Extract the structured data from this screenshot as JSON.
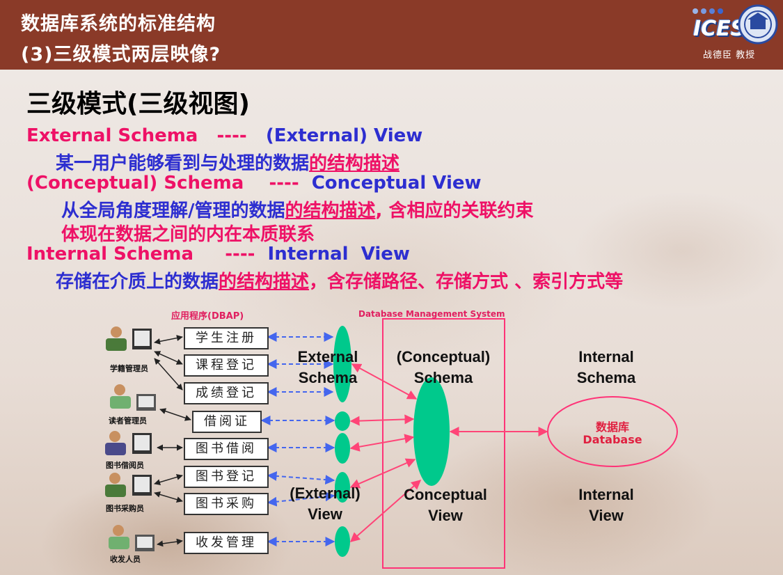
{
  "header": {
    "line1": "数据库系统的标准结构",
    "line2": "(3)三级模式两层映像?",
    "logo_text": "ICES",
    "author": "战德臣 教授"
  },
  "heading": "三级模式(三级视图)",
  "rows": {
    "r1": {
      "a": "External Schema   ----   ",
      "b": "(External) View"
    },
    "r2": {
      "a": "某一用户能够看到与处理的数据",
      "b": "的结构描述"
    },
    "r3": {
      "a": "(Conceptual) Schema    ----  ",
      "b": "Conceptual View"
    },
    "r4": {
      "a": "从全局角度理解/管理的数据",
      "b": "的结构描述",
      "c": ", 含相应的关联约束"
    },
    "r5": {
      "a": "体现在数据之间的内在本质联系"
    },
    "r6": {
      "a": "Internal Schema     ----  ",
      "b": "Internal  View"
    },
    "r7": {
      "a": "存储在介质上的数据",
      "b": "的结构描述",
      "c": "，含存储路径、存储方式 、索引方式等"
    }
  },
  "diagram": {
    "app_title": "应用程序(DBAP)",
    "dbms_title": "Database Management System",
    "apps": [
      "学生注册",
      "课程登记",
      "成绩登记",
      "借阅证",
      "图书借阅",
      "图书登记",
      "图书采购",
      "收发管理"
    ],
    "people": [
      "学籍管理员",
      "读者管理员",
      "图书借阅员",
      "图书采购员",
      "收发人员"
    ],
    "labels": {
      "external_schema": [
        "External",
        "Schema"
      ],
      "conceptual_schema": [
        "(Conceptual)",
        "Schema"
      ],
      "internal_schema": [
        "Internal",
        "Schema"
      ],
      "external_view": [
        "(External)",
        "View"
      ],
      "conceptual_view": [
        "Conceptual",
        "View"
      ],
      "internal_view": [
        "Internal",
        "View"
      ]
    },
    "database": {
      "cn": "数据库",
      "en": "Database"
    },
    "colors": {
      "ellipse": "#00c98c",
      "arrow": "#ff4477",
      "dashed": "#4466ee",
      "dbms_box": "#ff3377"
    }
  }
}
